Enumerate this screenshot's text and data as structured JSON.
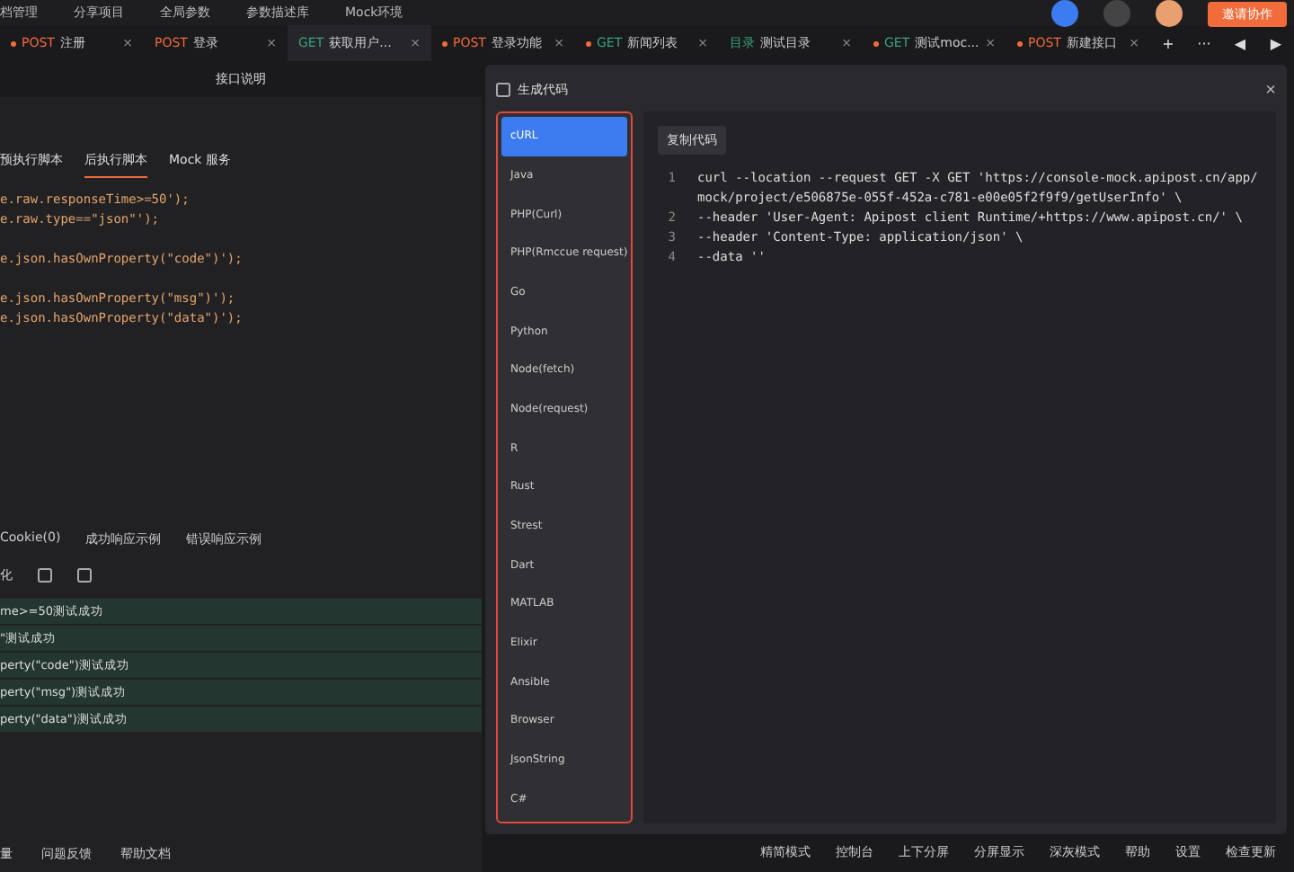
{
  "toolbar": [
    "档管理",
    "分享项目",
    "全局参数",
    "参数描述库",
    "Mock环境"
  ],
  "top_actions": {
    "invite_button": "邀请协作"
  },
  "tabs": [
    {
      "method": "POST",
      "name": "注册",
      "dot": true,
      "selected": false
    },
    {
      "method": "POST",
      "name": "登录",
      "dot": false,
      "selected": false
    },
    {
      "method": "GET",
      "name": "获取用户...",
      "dot": false,
      "selected": true
    },
    {
      "method": "POST",
      "name": "登录功能",
      "dot": true,
      "selected": false
    },
    {
      "method": "GET",
      "name": "新闻列表",
      "dot": true,
      "selected": false
    },
    {
      "method": "目录",
      "name": "测试目录",
      "dot": false,
      "selected": false
    },
    {
      "method": "GET",
      "name": "测试moc...",
      "dot": true,
      "selected": false
    },
    {
      "method": "POST",
      "name": "新建接口",
      "dot": true,
      "selected": false
    }
  ],
  "tab_controls": {
    "close": "×",
    "add": "+",
    "more": "···",
    "prev": "◀",
    "next": "▶"
  },
  "editor": {
    "doc_tab": "接口说明",
    "script_tabs": [
      {
        "label": "预执行脚本",
        "selected": false
      },
      {
        "label": "后执行脚本",
        "selected": true
      },
      {
        "label": "Mock 服务",
        "selected": false
      }
    ],
    "code_blocks": [
      [
        "e.raw.responseTime>=50');",
        "e.raw.type==\"json\"');"
      ],
      [
        "e.json.hasOwnProperty(\"code\")');"
      ],
      [
        "e.json.hasOwnProperty(\"msg\")');",
        "e.json.hasOwnProperty(\"data\")');"
      ]
    ]
  },
  "response": {
    "tabs": [
      {
        "label": "Cookie(0)",
        "selected": false
      },
      {
        "label": "成功响应示例",
        "selected": false
      },
      {
        "label": "错误响应示例",
        "selected": false
      }
    ],
    "toolbar_label": "化",
    "results": [
      "me>=50测试成功",
      "\"测试成功",
      "perty(\"code\")测试成功",
      "perty(\"msg\")测试成功",
      "perty(\"data\")测试成功"
    ]
  },
  "left_footer": [
    "量",
    "问题反馈",
    "帮助文档"
  ],
  "modal": {
    "title": "生成代码",
    "close": "×",
    "languages": [
      {
        "label": "cURL",
        "selected": true
      },
      {
        "label": "Java",
        "selected": false
      },
      {
        "label": "PHP(Curl)",
        "selected": false
      },
      {
        "label": "PHP(Rmccue request)",
        "selected": false
      },
      {
        "label": "Go",
        "selected": false
      },
      {
        "label": "Python",
        "selected": false
      },
      {
        "label": "Node(fetch)",
        "selected": false
      },
      {
        "label": "Node(request)",
        "selected": false
      },
      {
        "label": "R",
        "selected": false
      },
      {
        "label": "Rust",
        "selected": false
      },
      {
        "label": "Strest",
        "selected": false
      },
      {
        "label": "Dart",
        "selected": false
      },
      {
        "label": "MATLAB",
        "selected": false
      },
      {
        "label": "Elixir",
        "selected": false
      },
      {
        "label": "Ansible",
        "selected": false
      },
      {
        "label": "Browser",
        "selected": false
      },
      {
        "label": "JsonString",
        "selected": false
      },
      {
        "label": "C#",
        "selected": false
      }
    ],
    "copy_button": "复制代码",
    "code": [
      {
        "number": "1",
        "text": "curl --location --request GET -X GET 'https://console-mock.apipost.cn/app/mock/project/e506875e-055f-452a-c781-e00e05f2f9f9/getUserInfo' \\"
      },
      {
        "number": "2",
        "text": "--header 'User-Agent: Apipost client Runtime/+https://www.apipost.cn/' \\"
      },
      {
        "number": "3",
        "text": "--header 'Content-Type: application/json' \\"
      },
      {
        "number": "4",
        "text": "--data ''"
      }
    ]
  },
  "status_bar": [
    "精简模式",
    "控制台",
    "上下分屏",
    "分屏显示",
    "深灰模式",
    "帮助",
    "设置",
    "检查更新"
  ]
}
